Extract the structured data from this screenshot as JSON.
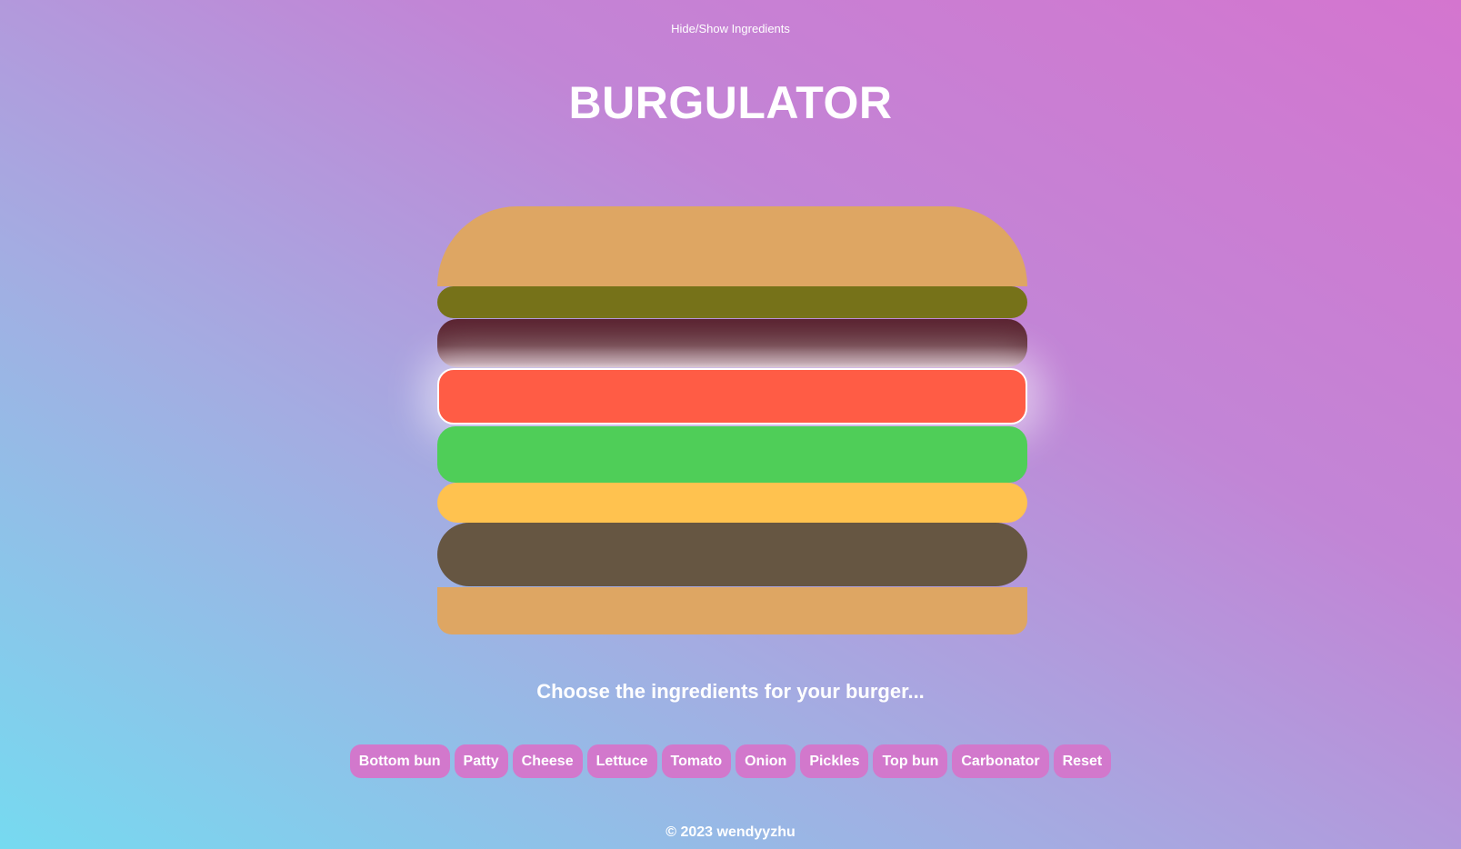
{
  "header": {
    "toggle_label": "Hide/Show Ingredients",
    "title": "BURGULATOR"
  },
  "burger": {
    "layers": [
      {
        "name": "Top bun",
        "color": "#dea663"
      },
      {
        "name": "Pickles",
        "color": "#767219"
      },
      {
        "name": "Onion",
        "color": "#5f2a36"
      },
      {
        "name": "Tomato",
        "color": "#ff5c45",
        "highlighted": true
      },
      {
        "name": "Lettuce",
        "color": "#4fce58"
      },
      {
        "name": "Cheese",
        "color": "#ffc24f"
      },
      {
        "name": "Patty",
        "color": "#665642"
      },
      {
        "name": "Bottom bun",
        "color": "#dea663"
      }
    ]
  },
  "prompt": "Choose the ingredients for your burger...",
  "buttons": [
    "Bottom bun",
    "Patty",
    "Cheese",
    "Lettuce",
    "Tomato",
    "Onion",
    "Pickles",
    "Top bun",
    "Carbonator",
    "Reset"
  ],
  "footer": "© 2023 wendyyzhu",
  "colors": {
    "button_bg": "#d278cc",
    "text": "#ffffff"
  }
}
